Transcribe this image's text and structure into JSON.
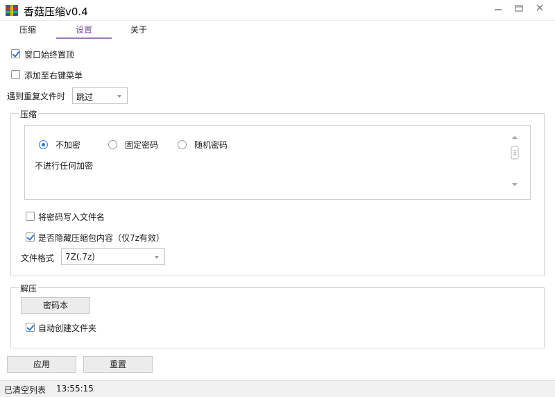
{
  "window": {
    "title": "香菇压缩v0.4"
  },
  "tabs": [
    {
      "label": "压缩"
    },
    {
      "label": "设置"
    },
    {
      "label": "关于"
    }
  ],
  "settings": {
    "always_on_top": {
      "label": "窗口始终置顶",
      "checked": true
    },
    "context_menu": {
      "label": "添加至右键菜单",
      "checked": false
    },
    "duplicate": {
      "label": "遇到重复文件时",
      "value": "跳过"
    }
  },
  "compress": {
    "group_title": "压缩",
    "radios": [
      {
        "label": "不加密",
        "selected": true
      },
      {
        "label": "固定密码",
        "selected": false
      },
      {
        "label": "随机密码",
        "selected": false
      }
    ],
    "description": "不进行任何加密",
    "write_password": {
      "label": "将密码写入文件名",
      "checked": false
    },
    "hide_content": {
      "label": "是否隐藏压缩包内容（仅7z有效）",
      "checked": true
    },
    "format": {
      "label": "文件格式",
      "value": "7Z(.7z)"
    }
  },
  "extract": {
    "group_title": "解压",
    "password_book": "密码本",
    "auto_folder": {
      "label": "自动创建文件夹",
      "checked": true
    }
  },
  "buttons": {
    "apply": "应用",
    "reset": "重置"
  },
  "status": {
    "message": "已清空列表",
    "time": "13:55:15"
  },
  "colors": {
    "accent": "#2b78d6",
    "tab_active": "#7a4f9a"
  }
}
